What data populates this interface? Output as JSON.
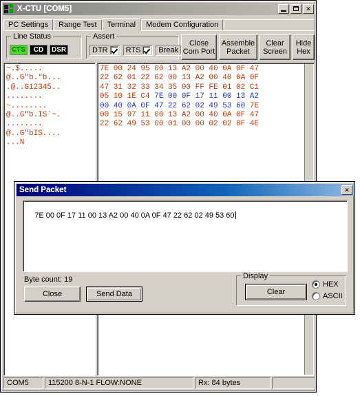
{
  "window": {
    "title": "X-CTU  [COM5]",
    "icon": "app-icon",
    "buttons": {
      "minimize": "_",
      "maximize": "□",
      "close": "✕"
    }
  },
  "tabs": [
    {
      "label": "PC Settings",
      "active": false
    },
    {
      "label": "Range Test",
      "active": false
    },
    {
      "label": "Terminal",
      "active": true
    },
    {
      "label": "Modem Configuration",
      "active": false
    }
  ],
  "line_status": {
    "legend": "Line Status",
    "leds": [
      {
        "label": "CTS",
        "on": true
      },
      {
        "label": "CD",
        "on": false
      },
      {
        "label": "DSR",
        "on": false
      }
    ],
    "on_color": "#44dd22",
    "off_color": "#000000"
  },
  "assert": {
    "legend": "Assert",
    "items": [
      {
        "label": "DTR",
        "checked": true
      },
      {
        "label": "RTS",
        "checked": true
      },
      {
        "label": "Break",
        "checked": false
      }
    ]
  },
  "toolbar": {
    "close_com_port": "Close\nCom Port",
    "assemble_packet": "Assemble\nPacket",
    "clear_screen": "Clear\nScreen",
    "hide_hex": "Hide\nHex"
  },
  "terminal": {
    "rx_color": "#cc3300",
    "tx_color": "#2233cc",
    "ascii_lines": [
      {
        "text": "~.$.....",
        "dir": "rx"
      },
      {
        "text": "@..G\"b.\"b...",
        "dir": "rx"
      },
      {
        "text": ".@..G12345..",
        "dir": "rx"
      },
      {
        "text": "........",
        "dir": "rx"
      },
      {
        "text": "~........",
        "dir": "rx"
      },
      {
        "text": "@..G\"b.IS`~.",
        "dir": "rx"
      },
      {
        "text": "........",
        "dir": "rx"
      },
      {
        "text": "@..G\"bIS....",
        "dir": "rx"
      },
      {
        "text": "...N",
        "dir": "rx"
      }
    ],
    "hex_lines": [
      {
        "segments": [
          {
            "text": "7E 00 24 95 00 13 A2 00 40 0A 0F 47",
            "dir": "rx"
          }
        ]
      },
      {
        "segments": [
          {
            "text": "22 62 01 22 62 00 13 A2 00 40 0A 0F",
            "dir": "rx"
          }
        ]
      },
      {
        "segments": [
          {
            "text": "47 31 32 33 34 35 00 FF FE 01 02 C1",
            "dir": "rx"
          }
        ]
      },
      {
        "segments": [
          {
            "text": "05 10 1E C4 ",
            "dir": "rx"
          },
          {
            "text": "7E 00 0F 17 11 00 13 A2",
            "dir": "tx"
          }
        ]
      },
      {
        "segments": [
          {
            "text": "00 40 0A 0F 47 22 62 02 49 53 60 ",
            "dir": "tx"
          },
          {
            "text": "7E",
            "dir": "rx"
          }
        ]
      },
      {
        "segments": [
          {
            "text": "00 15 97 11 00 13 A2 00 40 0A 0F 47",
            "dir": "rx"
          }
        ]
      },
      {
        "segments": [
          {
            "text": "22 62 49 53 00 01 00 00 02 02 8F 4E",
            "dir": "rx"
          }
        ]
      }
    ]
  },
  "status_bar": {
    "port": "COM5",
    "config": "115200 8-N-1  FLOW:NONE",
    "rx": "Rx: 84 bytes",
    "extra": ""
  },
  "send_packet_dialog": {
    "title": "Send Packet",
    "close_button": "✕",
    "packet_value": "7E 00 0F 17 11 00 13 A2 00 40 0A 0F 47 22 62 02 49 53 60",
    "packet_placeholder": "",
    "byte_count_label": "Byte count: 19",
    "close_label": "Close",
    "send_data_label": "Send Data",
    "display": {
      "legend": "Display",
      "clear_label": "Clear",
      "options": [
        {
          "label": "HEX",
          "selected": true
        },
        {
          "label": "ASCII",
          "selected": false
        }
      ]
    }
  }
}
